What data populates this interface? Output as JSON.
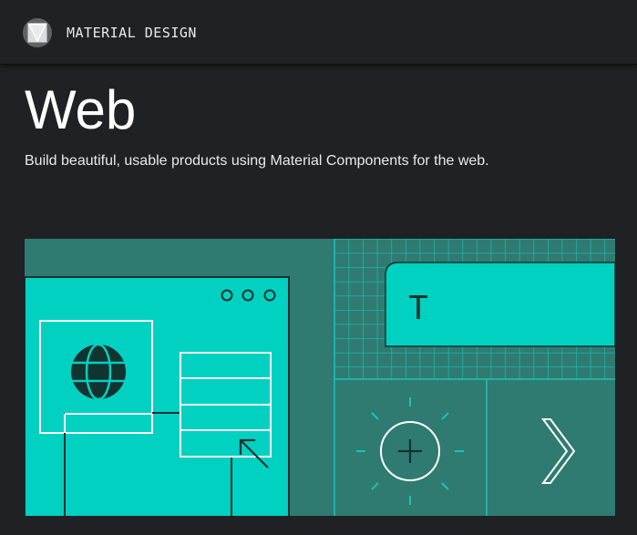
{
  "header": {
    "brand": "MATERIAL DESIGN",
    "logo_icon": "material-design-logo-icon"
  },
  "page": {
    "title": "Web",
    "subtitle": "Build beautiful, usable products using Material Components for the web."
  },
  "hero": {
    "text_glyph": "T",
    "icons": [
      "globe-icon",
      "cursor-arrow-icon",
      "add-circle-icon",
      "chevron-right-icon",
      "browser-dots-icon",
      "text-field-icon"
    ],
    "colors": {
      "teal_dark": "#2f7b72",
      "teal_bright": "#00d1c1",
      "grid_line": "#18c4b6",
      "line_light": "#ffffff",
      "line_dark": "#123330"
    }
  },
  "theme": {
    "background": "#202124",
    "text_primary": "#ffffff",
    "text_secondary": "#e8eaed"
  }
}
